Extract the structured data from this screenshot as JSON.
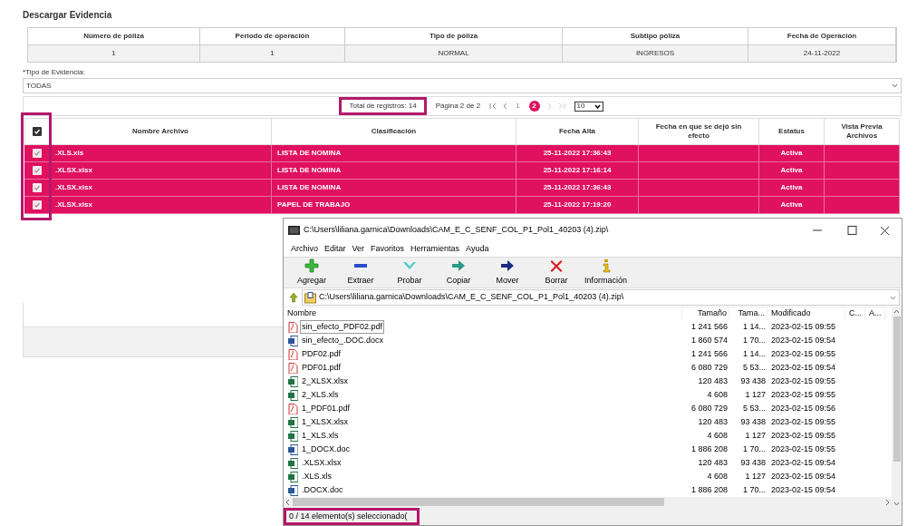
{
  "page_title": "Descargar Evidencia",
  "policy_table": {
    "columns": [
      "Número de póliza",
      "Periodo de operación",
      "Tipo de póliza",
      "Subtipo póliza",
      "Fecha de Operación"
    ],
    "rows": [
      [
        "1",
        "1",
        "NORMAL",
        "INGRESOS",
        "24-11-2022"
      ]
    ]
  },
  "evidence_type": {
    "label": "*Tipo de Evidencia:",
    "value": "TODAS"
  },
  "pagination": {
    "total": "Total de registros: 14",
    "total_highlighted": true,
    "page_info": "Página 2 de 2",
    "pages": [
      {
        "label": "1",
        "selected": false
      },
      {
        "label": "2",
        "selected": true
      }
    ],
    "prev_disabled": false,
    "next_disabled": true,
    "page_size": "10"
  },
  "files_table": {
    "select_all_checked": true,
    "checkbox_column_highlighted": true,
    "columns": [
      "Nombre Archivo",
      "Clasificación",
      "Fecha Alta",
      "Fecha en que se dejó sin efecto",
      "Estatus",
      "Vista Previa Archivos"
    ],
    "rows": [
      {
        "checked": true,
        "selected": true,
        "cells": [
          ".XLS.xls",
          "LISTA DE NOMINA",
          "25-11-2022 17:36:43",
          "",
          "Activa",
          ""
        ]
      },
      {
        "checked": true,
        "selected": true,
        "cells": [
          ".XLSX.xlsx",
          "LISTA DE NOMINA",
          "25-11-2022 17:16:14",
          "",
          "Activa",
          ""
        ]
      },
      {
        "checked": true,
        "selected": true,
        "cells": [
          ".XLSX.xlsx",
          "LISTA DE NOMINA",
          "25-11-2022 17:36:43",
          "",
          "Activa",
          ""
        ]
      },
      {
        "checked": true,
        "selected": true,
        "cells": [
          ".XLSX.xlsx",
          "PAPEL DE TRABAJO",
          "25-11-2022 17:19:20",
          "",
          "Activa",
          ""
        ]
      }
    ]
  },
  "archive_window": {
    "title": "C:\\Users\\liliana.garnica\\Downloads\\CAM_E_C_SENF_COL_P1_Pol1_40203 (4).zip\\",
    "menu": [
      "Archivo",
      "Editar",
      "Ver",
      "Favoritos",
      "Herramientas",
      "Ayuda"
    ],
    "toolbar": [
      {
        "label": "Agregar",
        "kind": "add"
      },
      {
        "label": "Extraer",
        "kind": "extract"
      },
      {
        "label": "Probar",
        "kind": "test"
      },
      {
        "label": "Copiar",
        "kind": "copy"
      },
      {
        "label": "Mover",
        "kind": "move"
      },
      {
        "label": "Borrar",
        "kind": "delete"
      },
      {
        "label": "Información",
        "kind": "info"
      }
    ],
    "address": "C:\\Users\\liliana.garnica\\Downloads\\CAM_E_C_SENF_COL_P1_Pol1_40203 (4).zip\\",
    "columns": [
      "Nombre",
      "Tamaño",
      "Tama...",
      "Modificado",
      "C...",
      "A..."
    ],
    "rows": [
      {
        "kind": "pdf",
        "focused": true,
        "name": "sin_efecto_PDF02.pdf",
        "size": "1 241 566",
        "packed": "1 14...",
        "modified": "2023-02-15 09:55"
      },
      {
        "kind": "word",
        "focused": false,
        "name": "sin_efecto_.DOC.docx",
        "size": "1 860 574",
        "packed": "1 70...",
        "modified": "2023-02-15 09:54"
      },
      {
        "kind": "pdf",
        "focused": false,
        "name": "PDF02.pdf",
        "size": "1 241 566",
        "packed": "1 14...",
        "modified": "2023-02-15 09:55"
      },
      {
        "kind": "pdf",
        "focused": false,
        "name": "PDF01.pdf",
        "size": "6 080 729",
        "packed": "5 53...",
        "modified": "2023-02-15 09:54"
      },
      {
        "kind": "excel",
        "focused": false,
        "name": "2_XLSX.xlsx",
        "size": "120 483",
        "packed": "93 438",
        "modified": "2023-02-15 09:55"
      },
      {
        "kind": "excel",
        "focused": false,
        "name": "2_XLS.xls",
        "size": "4 608",
        "packed": "1 127",
        "modified": "2023-02-15 09:55"
      },
      {
        "kind": "pdf",
        "focused": false,
        "name": "1_PDF01.pdf",
        "size": "6 080 729",
        "packed": "5 53...",
        "modified": "2023-02-15 09:56"
      },
      {
        "kind": "excel",
        "focused": false,
        "name": "1_XLSX.xlsx",
        "size": "120 483",
        "packed": "93 438",
        "modified": "2023-02-15 09:55"
      },
      {
        "kind": "excel",
        "focused": false,
        "name": "1_XLS.xls",
        "size": "4 608",
        "packed": "1 127",
        "modified": "2023-02-15 09:55"
      },
      {
        "kind": "word",
        "focused": false,
        "name": "1_DOCX.doc",
        "size": "1 886 208",
        "packed": "1 70...",
        "modified": "2023-02-15 09:55"
      },
      {
        "kind": "excel",
        "focused": false,
        "name": ".XLSX.xlsx",
        "size": "120 483",
        "packed": "93 438",
        "modified": "2023-02-15 09:54"
      },
      {
        "kind": "excel",
        "focused": false,
        "name": ".XLS.xls",
        "size": "4 608",
        "packed": "1 127",
        "modified": "2023-02-15 09:54"
      },
      {
        "kind": "word",
        "focused": false,
        "name": ".DOCX.doc",
        "size": "1 886 208",
        "packed": "1 70...",
        "modified": "2023-02-15 09:54"
      }
    ],
    "status": "0 / 14 elemento(s) seleccionado(",
    "status_highlighted": true
  }
}
